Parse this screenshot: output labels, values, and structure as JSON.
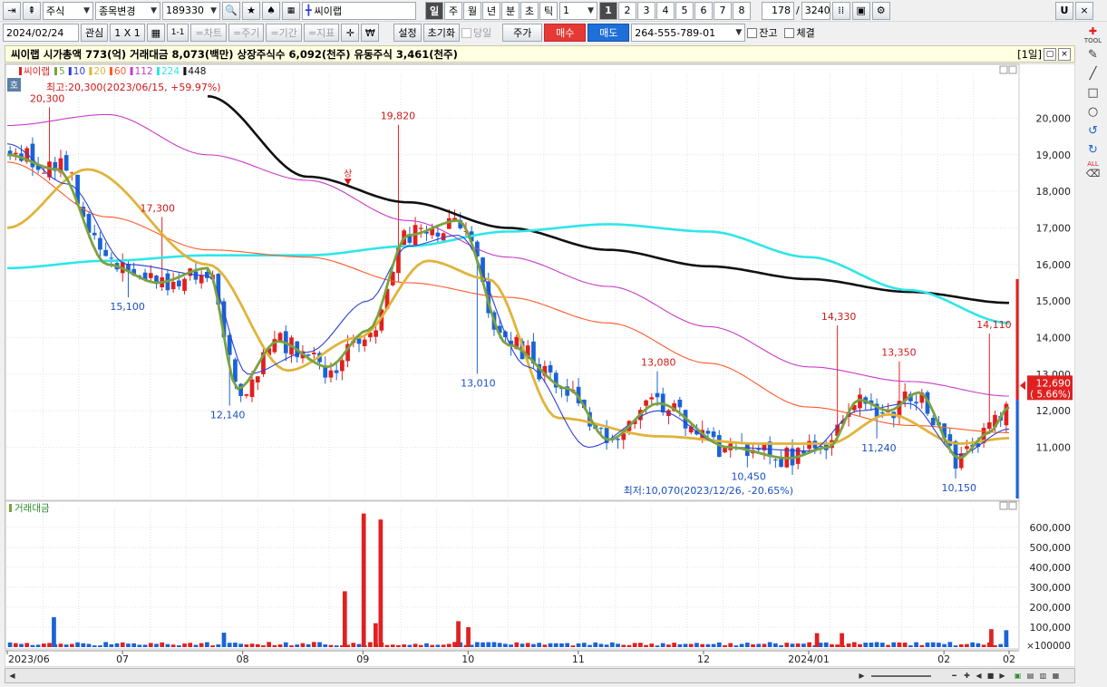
{
  "toolbar": {
    "market": "주식",
    "change_stock": "종목변경",
    "code": "189330",
    "name": "씨이랩",
    "period_tabs": [
      "일",
      "주",
      "월",
      "년",
      "분",
      "초",
      "틱"
    ],
    "interval": "1",
    "page_buttons": [
      "1",
      "2",
      "3",
      "4",
      "5",
      "6",
      "7",
      "8"
    ],
    "count": "178",
    "slash": "/",
    "total": "3240",
    "right_letter": "U"
  },
  "toolbar2": {
    "date": "2024/02/24",
    "watch": "관심",
    "layout": "1 X 1",
    "link": "1-1",
    "chart_btn": "=차트",
    "cycle_btn": "=주기",
    "period_btn": "=기간",
    "indicator_btn": "=지표",
    "setup": "설정",
    "reset": "초기화",
    "today": "당일",
    "price": "주가",
    "buy": "매수",
    "sell": "매도",
    "account": "264-555-789-01",
    "balance": "잔고",
    "filled": "체결"
  },
  "info": {
    "text": "씨이랩  시가총액 773(억)  거래대금 8,073(백만)  상장주식수 6,092(천주)  유동주식 3,461(천주)",
    "period": "[1일]"
  },
  "sidebar": {
    "tool_label": "TOOL",
    "all_label": "ALL"
  },
  "colors": {
    "up": "#e02020",
    "down": "#1a63d6",
    "ma5": "#7ba23f",
    "ma10": "#2b3fd6",
    "ma20": "#e0b43a",
    "ma60": "#ff5a2a",
    "ma112": "#c83cc8",
    "ma224": "#2ee6ea",
    "ma448": "#111111"
  },
  "chart_data": {
    "type": "candlestick",
    "legend": [
      {
        "name": "씨이랩",
        "color": "#e02020"
      },
      {
        "name": "5",
        "color": "#7ba23f"
      },
      {
        "name": "10",
        "color": "#2b3fd6"
      },
      {
        "name": "20",
        "color": "#e0b43a"
      },
      {
        "name": "60",
        "color": "#ff5a2a"
      },
      {
        "name": "112",
        "color": "#c83cc8"
      },
      {
        "name": "224",
        "color": "#2ee6ea"
      },
      {
        "name": "448",
        "color": "#111111"
      }
    ],
    "badge": "호",
    "high_note": "최고:20,300(2023/06/15, +59.97%)",
    "low_note": "최저:10,070(2023/12/26, -20.65%)",
    "upper_limit_mark": "상",
    "annotations": [
      {
        "text": "20,300",
        "price": 20300,
        "t": 0.04,
        "kind": "high"
      },
      {
        "text": "17,300",
        "price": 17300,
        "t": 0.15,
        "kind": "high"
      },
      {
        "text": "15,100",
        "price": 15100,
        "t": 0.12,
        "kind": "low"
      },
      {
        "text": "12,140",
        "price": 12140,
        "t": 0.22,
        "kind": "low"
      },
      {
        "text": "19,820",
        "price": 19820,
        "t": 0.39,
        "kind": "high"
      },
      {
        "text": "13,010",
        "price": 13010,
        "t": 0.47,
        "kind": "low"
      },
      {
        "text": "13,080",
        "price": 13080,
        "t": 0.65,
        "kind": "high"
      },
      {
        "text": "10,450",
        "price": 10450,
        "t": 0.74,
        "kind": "low"
      },
      {
        "text": "14,330",
        "price": 14330,
        "t": 0.83,
        "kind": "high"
      },
      {
        "text": "13,350",
        "price": 13350,
        "t": 0.89,
        "kind": "high"
      },
      {
        "text": "11,240",
        "price": 11240,
        "t": 0.87,
        "kind": "low"
      },
      {
        "text": "10,150",
        "price": 10150,
        "t": 0.95,
        "kind": "low"
      },
      {
        "text": "14,110",
        "price": 14110,
        "t": 0.985,
        "kind": "high"
      }
    ],
    "y_ticks": [
      "20,000",
      "19,000",
      "18,000",
      "17,000",
      "16,000",
      "15,000",
      "14,000",
      "13,000",
      "12,000",
      "11,000"
    ],
    "y_tick_values": [
      20000,
      19000,
      18000,
      17000,
      16000,
      15000,
      14000,
      13000,
      12000,
      11000
    ],
    "ylim": [
      9600,
      21200
    ],
    "current_price": "12,690",
    "current_change": "( 5.66%)",
    "current_value": 12690,
    "volume_label": "거래대금",
    "vol_ticks": [
      "600,000",
      "500,000",
      "400,000",
      "300,000",
      "200,000",
      "100,000"
    ],
    "vol_tick_values": [
      600000,
      500000,
      400000,
      300000,
      200000,
      100000
    ],
    "vol_unit": "×100000",
    "vol_max": 700000,
    "x_labels": [
      {
        "text": "2023/06",
        "t": 0.0
      },
      {
        "text": "07",
        "t": 0.115
      },
      {
        "text": "08",
        "t": 0.235
      },
      {
        "text": "09",
        "t": 0.355
      },
      {
        "text": "10",
        "t": 0.46
      },
      {
        "text": "11",
        "t": 0.57
      },
      {
        "text": "12",
        "t": 0.695
      },
      {
        "text": "2024/01",
        "t": 0.8
      },
      {
        "text": "02",
        "t": 0.935
      },
      {
        "text": "02",
        "t": 1.0
      }
    ],
    "ma448": [
      [
        0.2,
        20600
      ],
      [
        0.3,
        18400
      ],
      [
        0.4,
        17700
      ],
      [
        0.5,
        17000
      ],
      [
        0.6,
        16400
      ],
      [
        0.7,
        15950
      ],
      [
        0.8,
        15600
      ],
      [
        0.9,
        15250
      ],
      [
        1.0,
        14950
      ]
    ],
    "ma224": [
      [
        0.0,
        15900
      ],
      [
        0.1,
        16100
      ],
      [
        0.2,
        16250
      ],
      [
        0.3,
        16250
      ],
      [
        0.4,
        16500
      ],
      [
        0.5,
        16900
      ],
      [
        0.6,
        17100
      ],
      [
        0.7,
        16900
      ],
      [
        0.8,
        16200
      ],
      [
        0.9,
        15300
      ],
      [
        1.0,
        14400
      ]
    ],
    "ma112": [
      [
        0.0,
        19800
      ],
      [
        0.1,
        20100
      ],
      [
        0.2,
        19000
      ],
      [
        0.3,
        18300
      ],
      [
        0.4,
        17200
      ],
      [
        0.5,
        16200
      ],
      [
        0.6,
        15400
      ],
      [
        0.7,
        14300
      ],
      [
        0.8,
        13200
      ],
      [
        0.9,
        12800
      ],
      [
        1.0,
        12400
      ]
    ],
    "ma60": [
      [
        0.0,
        18800
      ],
      [
        0.1,
        17300
      ],
      [
        0.2,
        16400
      ],
      [
        0.3,
        16200
      ],
      [
        0.4,
        15500
      ],
      [
        0.5,
        15100
      ],
      [
        0.6,
        14400
      ],
      [
        0.7,
        13300
      ],
      [
        0.8,
        12100
      ],
      [
        0.9,
        11600
      ],
      [
        1.0,
        11400
      ]
    ],
    "ma20": [
      [
        0.0,
        17000
      ],
      [
        0.08,
        18600
      ],
      [
        0.2,
        16000
      ],
      [
        0.28,
        13100
      ],
      [
        0.35,
        14000
      ],
      [
        0.42,
        16100
      ],
      [
        0.48,
        15600
      ],
      [
        0.55,
        11800
      ],
      [
        0.65,
        11300
      ],
      [
        0.75,
        11100
      ],
      [
        0.82,
        11100
      ],
      [
        0.88,
        11900
      ],
      [
        0.95,
        11100
      ],
      [
        1.0,
        11250
      ]
    ],
    "ma10": [
      [
        0.0,
        19300
      ],
      [
        0.06,
        18200
      ],
      [
        0.12,
        16000
      ],
      [
        0.2,
        15700
      ],
      [
        0.24,
        13000
      ],
      [
        0.3,
        13600
      ],
      [
        0.36,
        15000
      ],
      [
        0.4,
        16500
      ],
      [
        0.45,
        16800
      ],
      [
        0.52,
        13200
      ],
      [
        0.58,
        11000
      ],
      [
        0.65,
        12000
      ],
      [
        0.72,
        11000
      ],
      [
        0.8,
        10900
      ],
      [
        0.85,
        12000
      ],
      [
        0.9,
        12200
      ],
      [
        0.95,
        10800
      ],
      [
        1.0,
        11500
      ]
    ],
    "ma5": [
      [
        0.0,
        19000
      ],
      [
        0.05,
        18600
      ],
      [
        0.1,
        16000
      ],
      [
        0.15,
        15500
      ],
      [
        0.2,
        15900
      ],
      [
        0.23,
        12600
      ],
      [
        0.27,
        13900
      ],
      [
        0.32,
        13200
      ],
      [
        0.36,
        14200
      ],
      [
        0.4,
        16800
      ],
      [
        0.45,
        17200
      ],
      [
        0.5,
        13800
      ],
      [
        0.56,
        12600
      ],
      [
        0.6,
        11200
      ],
      [
        0.65,
        12200
      ],
      [
        0.72,
        11000
      ],
      [
        0.78,
        10700
      ],
      [
        0.82,
        11000
      ],
      [
        0.85,
        12300
      ],
      [
        0.88,
        12000
      ],
      [
        0.91,
        12500
      ],
      [
        0.95,
        10700
      ],
      [
        0.98,
        11400
      ],
      [
        1.0,
        12100
      ]
    ]
  }
}
